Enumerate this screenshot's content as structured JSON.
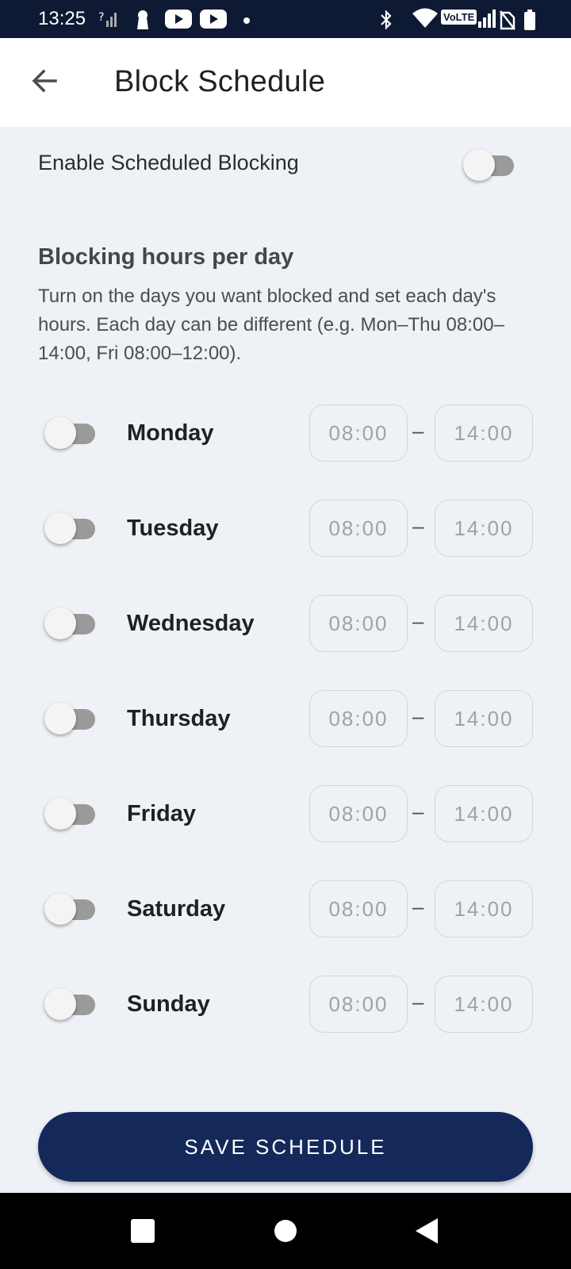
{
  "status_bar": {
    "time": "13:25",
    "network_label": "VoLTE",
    "icons": [
      "unknown-signal-icon",
      "keyhole-icon",
      "youtube-icon",
      "youtube-icon",
      "dot-icon",
      "bluetooth-icon",
      "wifi-icon",
      "volte-icon",
      "signal-icon",
      "no-sim-icon",
      "battery-icon"
    ]
  },
  "app_bar": {
    "title": "Block Schedule",
    "back_icon": "arrow-left-icon"
  },
  "enable": {
    "label": "Enable Scheduled Blocking",
    "enabled": false
  },
  "section": {
    "title": "Blocking hours per day",
    "description": "Turn on the days you want blocked and set each day's hours. Each day can be different (e.g. Mon–Thu 08:00–14:00, Fri 08:00–12:00)."
  },
  "days": [
    {
      "name": "Monday",
      "enabled": false,
      "start": "08:00",
      "end": "14:00"
    },
    {
      "name": "Tuesday",
      "enabled": false,
      "start": "08:00",
      "end": "14:00"
    },
    {
      "name": "Wednesday",
      "enabled": false,
      "start": "08:00",
      "end": "14:00"
    },
    {
      "name": "Thursday",
      "enabled": false,
      "start": "08:00",
      "end": "14:00"
    },
    {
      "name": "Friday",
      "enabled": false,
      "start": "08:00",
      "end": "14:00"
    },
    {
      "name": "Saturday",
      "enabled": false,
      "start": "08:00",
      "end": "14:00"
    },
    {
      "name": "Sunday",
      "enabled": false,
      "start": "08:00",
      "end": "14:00"
    }
  ],
  "separator": "–",
  "save_button": {
    "label": "SAVE SCHEDULE"
  },
  "nav_bar": {
    "icons": [
      "recents-square-icon",
      "home-circle-icon",
      "back-triangle-icon"
    ]
  },
  "colors": {
    "status_bar": "#0e1a33",
    "primary": "#14295a",
    "background": "#eef2f6"
  }
}
